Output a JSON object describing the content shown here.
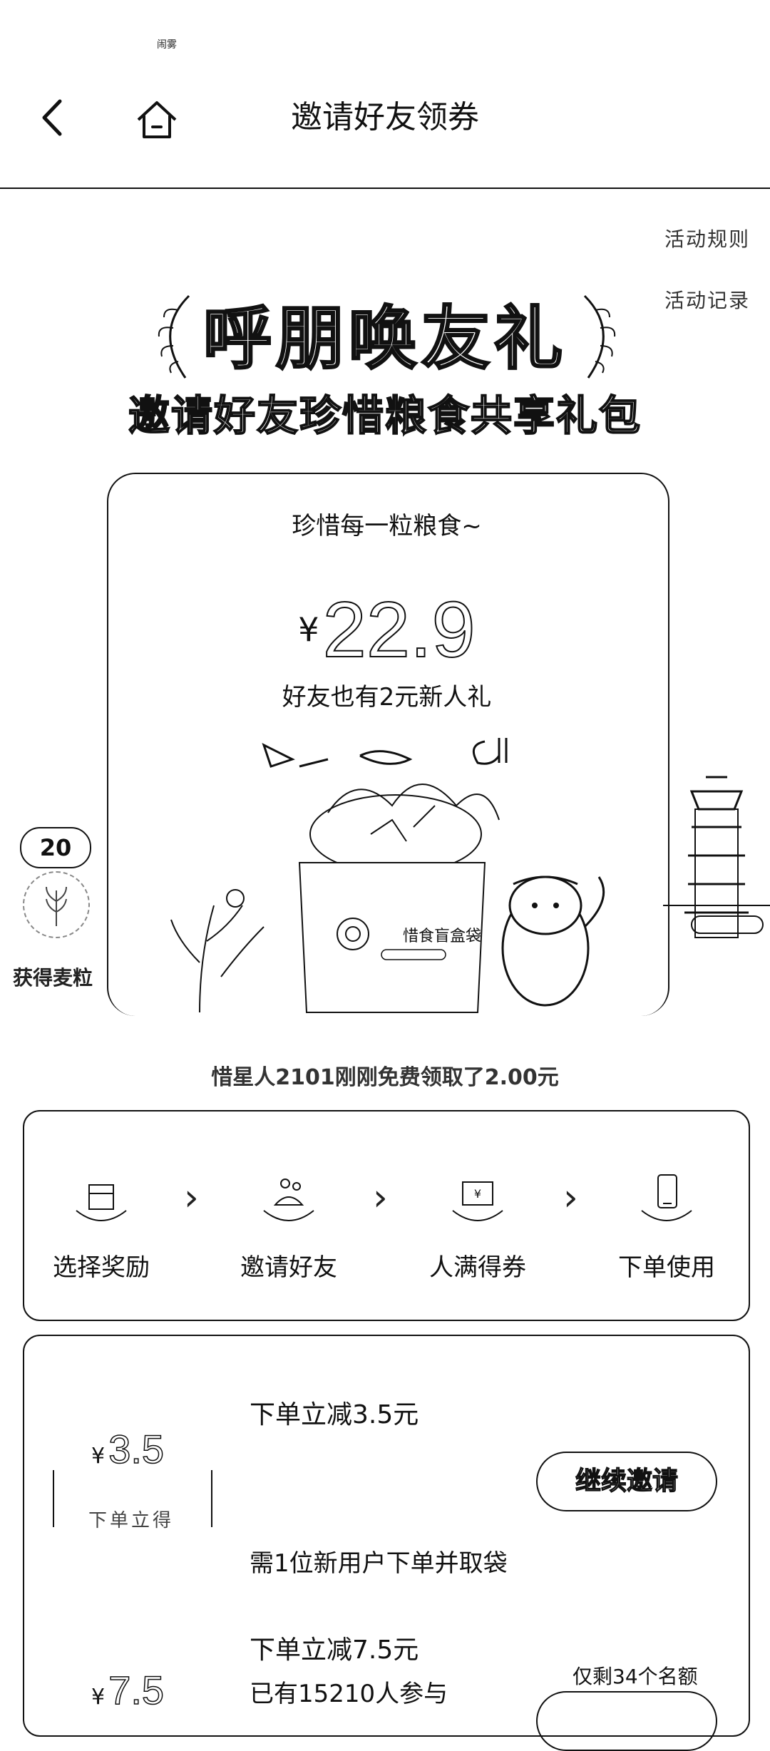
{
  "status_bar": {
    "mark": "闹雾"
  },
  "header": {
    "title": "邀请好友领券"
  },
  "links": {
    "rules": "活动规则",
    "records": "活动记录"
  },
  "hero": {
    "title": "呼朋唤友礼",
    "subtitle": "邀请好友珍惜粮食共享礼包"
  },
  "card": {
    "tagline": "珍惜每一粒粮食~",
    "currency": "¥",
    "amount": "22.9",
    "friend_gift": "好友也有2元新人礼",
    "bag_label": "惜食盲盒袋"
  },
  "side": {
    "counter": "20",
    "label": "获得麦粒"
  },
  "ticker": "惜星人2101刚刚免费领取了2.00元",
  "steps": [
    {
      "label": "选择奖励",
      "icon": "gift-icon"
    },
    {
      "label": "邀请好友",
      "icon": "people-icon"
    },
    {
      "label": "人满得券",
      "icon": "coupon-icon"
    },
    {
      "label": "下单使用",
      "icon": "phone-icon"
    }
  ],
  "rewards": [
    {
      "currency": "¥",
      "amount": "3.5",
      "voucher_label": "下单立得",
      "title": "下单立减3.5元",
      "requirement": "需1位新用户下单并取袋",
      "button": "继续邀请"
    },
    {
      "currency": "¥",
      "amount": "7.5",
      "title": "下单立减7.5元",
      "participants": "已有15210人参与",
      "remaining": "仅剩34个名额"
    }
  ]
}
